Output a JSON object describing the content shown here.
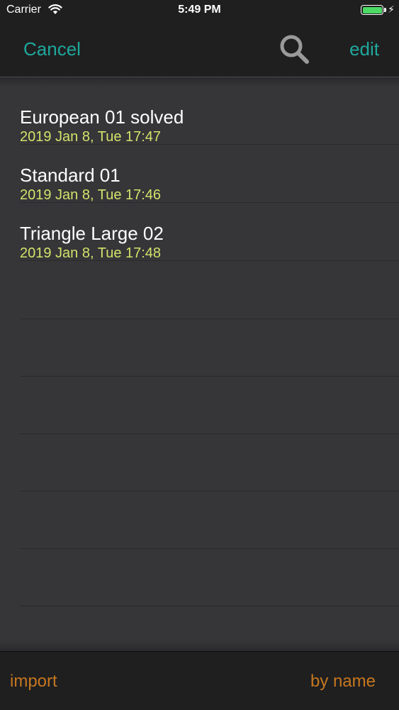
{
  "status_bar": {
    "carrier": "Carrier",
    "time": "5:49 PM",
    "battery_level": 1.0,
    "battery_color": "#4cd964"
  },
  "nav": {
    "cancel_label": "Cancel",
    "search_icon": "search-icon",
    "edit_label": "edit"
  },
  "list": {
    "items": [
      {
        "title": "European 01 solved",
        "date": "2019 Jan 8, Tue 17:47"
      },
      {
        "title": "Standard 01",
        "date": "2019 Jan 8, Tue 17:46"
      },
      {
        "title": "Triangle Large 02",
        "date": "2019 Jan 8, Tue 17:48"
      }
    ]
  },
  "bottom_bar": {
    "import_label": "import",
    "sort_label": "by name"
  },
  "colors": {
    "accent": "#1fa89c",
    "date": "#d3e36b",
    "bottom_accent": "#c6771f",
    "background": "#343336"
  }
}
